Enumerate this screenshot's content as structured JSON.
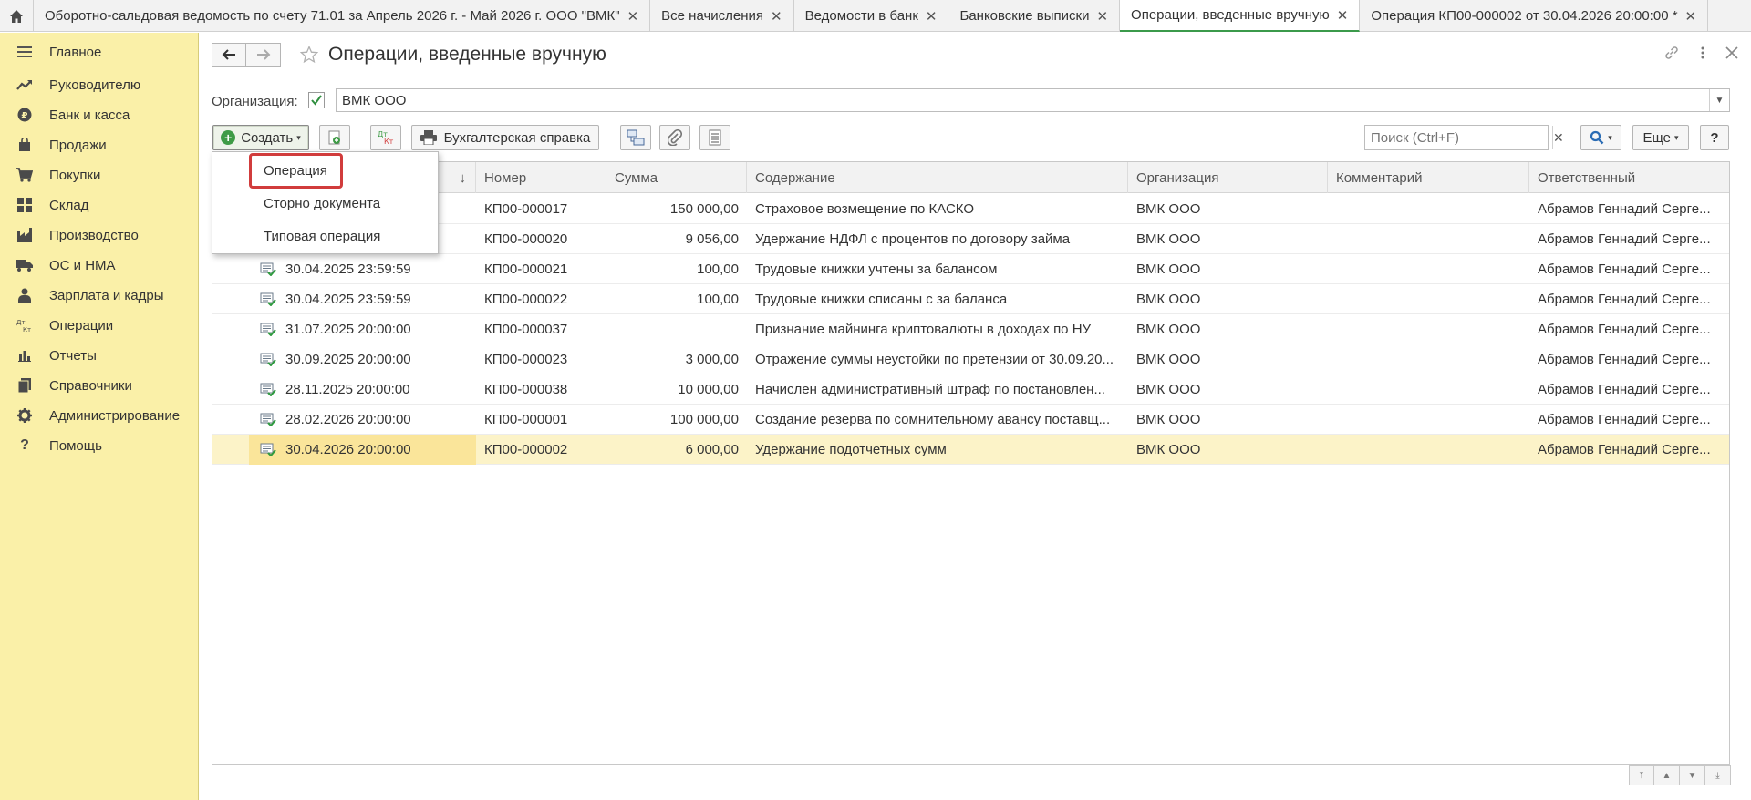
{
  "tabs": [
    {
      "label": "Оборотно-сальдовая ведомость по счету 71.01 за Апрель 2026 г. - Май 2026 г. ООО \"ВМК\"",
      "active": false
    },
    {
      "label": "Все начисления",
      "active": false
    },
    {
      "label": "Ведомости в банк",
      "active": false
    },
    {
      "label": "Банковские выписки",
      "active": false
    },
    {
      "label": "Операции, введенные вручную",
      "active": true
    },
    {
      "label": "Операция КП00-000002 от 30.04.2026 20:00:00 *",
      "active": false
    }
  ],
  "sidebar": {
    "items": [
      {
        "label": "Главное",
        "icon": "menu-icon"
      },
      {
        "label": "Руководителю",
        "icon": "trend-icon"
      },
      {
        "label": "Банк и касса",
        "icon": "ruble-icon"
      },
      {
        "label": "Продажи",
        "icon": "bag-icon"
      },
      {
        "label": "Покупки",
        "icon": "cart-icon"
      },
      {
        "label": "Склад",
        "icon": "warehouse-icon"
      },
      {
        "label": "Производство",
        "icon": "factory-icon"
      },
      {
        "label": "ОС и НМА",
        "icon": "truck-icon"
      },
      {
        "label": "Зарплата и кадры",
        "icon": "person-icon"
      },
      {
        "label": "Операции",
        "icon": "dt-kt-icon"
      },
      {
        "label": "Отчеты",
        "icon": "bar-chart-icon"
      },
      {
        "label": "Справочники",
        "icon": "books-icon"
      },
      {
        "label": "Администрирование",
        "icon": "gear-icon"
      },
      {
        "label": "Помощь",
        "icon": "question-icon"
      }
    ]
  },
  "header": {
    "title": "Операции, введенные вручную"
  },
  "filter": {
    "org_label": "Организация:",
    "org_value": "ВМК ООО",
    "org_checked": true
  },
  "toolbar": {
    "create_label": "Создать",
    "report_label": "Бухгалтерская справка",
    "search_placeholder": "Поиск (Ctrl+F)",
    "more_label": "Еще",
    "help_label": "?"
  },
  "create_menu": {
    "items": [
      "Операция",
      "Сторно документа",
      "Типовая операция"
    ]
  },
  "table": {
    "columns": [
      "Номер",
      "Сумма",
      "Содержание",
      "Организация",
      "Комментарий",
      "Ответственный"
    ],
    "sort_arrow": "↓",
    "rows": [
      {
        "date": "",
        "number": "КП00-000017",
        "sum": "150 000,00",
        "content": "Страховое возмещение по КАСКО",
        "org": "ВМК ООО",
        "comment": "",
        "resp": "Абрамов Геннадий Серге..."
      },
      {
        "date": "",
        "number": "КП00-000020",
        "sum": "9 056,00",
        "content": "Удержание НДФЛ с процентов по договору займа",
        "org": "ВМК ООО",
        "comment": "",
        "resp": "Абрамов Геннадий Серге..."
      },
      {
        "date": "30.04.2025 23:59:59",
        "number": "КП00-000021",
        "sum": "100,00",
        "content": "Трудовые книжки учтены за балансом",
        "org": "ВМК ООО",
        "comment": "",
        "resp": "Абрамов Геннадий Серге..."
      },
      {
        "date": "30.04.2025 23:59:59",
        "number": "КП00-000022",
        "sum": "100,00",
        "content": "Трудовые книжки списаны с за баланса",
        "org": "ВМК ООО",
        "comment": "",
        "resp": "Абрамов Геннадий Серге..."
      },
      {
        "date": "31.07.2025 20:00:00",
        "number": "КП00-000037",
        "sum": "",
        "content": "Признание майнинга криптовалюты в доходах по НУ",
        "org": "ВМК ООО",
        "comment": "",
        "resp": "Абрамов Геннадий Серге..."
      },
      {
        "date": "30.09.2025 20:00:00",
        "number": "КП00-000023",
        "sum": "3 000,00",
        "content": "Отражение суммы неустойки по претензии от 30.09.20...",
        "org": "ВМК ООО",
        "comment": "",
        "resp": "Абрамов Геннадий Серге..."
      },
      {
        "date": "28.11.2025 20:00:00",
        "number": "КП00-000038",
        "sum": "10 000,00",
        "content": "Начислен административный штраф по постановлен...",
        "org": "ВМК ООО",
        "comment": "",
        "resp": "Абрамов Геннадий Серге..."
      },
      {
        "date": "28.02.2026 20:00:00",
        "number": "КП00-000001",
        "sum": "100 000,00",
        "content": "Создание резерва по сомнительному авансу поставщ...",
        "org": "ВМК ООО",
        "comment": "",
        "resp": "Абрамов Геннадий Серге..."
      },
      {
        "date": "30.04.2026 20:00:00",
        "number": "КП00-000002",
        "sum": "6 000,00",
        "content": "Удержание подотчетных сумм",
        "org": "ВМК ООО",
        "comment": "",
        "resp": "Абрамов Геннадий Серге...",
        "selected": true
      }
    ]
  },
  "colors": {
    "sidebar_bg": "#faf0a8",
    "selected_row": "#fcf3c8",
    "accent_green": "#3f9b47",
    "highlight_red": "#d13c3c"
  }
}
